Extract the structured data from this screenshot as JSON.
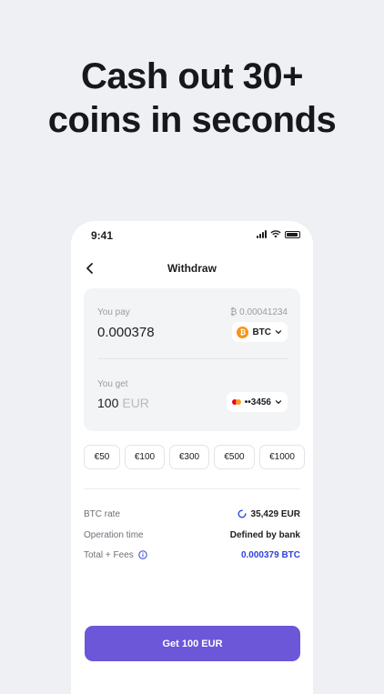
{
  "headline": {
    "line1": "Cash out 30+",
    "line2": "coins in seconds"
  },
  "status_bar": {
    "time": "9:41"
  },
  "nav": {
    "title": "Withdraw",
    "back_icon": "chevron-left-icon"
  },
  "pay": {
    "label": "You pay",
    "balance": "₿ 0.00041234",
    "amount": "0.000378",
    "coin": {
      "symbol": "BTC",
      "icon": "bitcoin-icon",
      "color": "#f7931a"
    }
  },
  "get": {
    "label": "You get",
    "amount": "100",
    "currency": "EUR",
    "card": {
      "masked": "••3456",
      "icon": "mastercard-icon"
    }
  },
  "quick_amounts": [
    "€50",
    "€100",
    "€300",
    "€500",
    "€1000"
  ],
  "details": {
    "rate": {
      "label": "BTC rate",
      "value": "35,429 EUR"
    },
    "operation_time": {
      "label": "Operation time",
      "value": "Defined by bank"
    },
    "total": {
      "label": "Total + Fees",
      "value": "0.000379 BTC"
    }
  },
  "cta": {
    "label": "Get 100 EUR"
  },
  "colors": {
    "accent": "#6b57d8",
    "link": "#2f43d6",
    "btc": "#f7931a",
    "background": "#eef0f3"
  }
}
